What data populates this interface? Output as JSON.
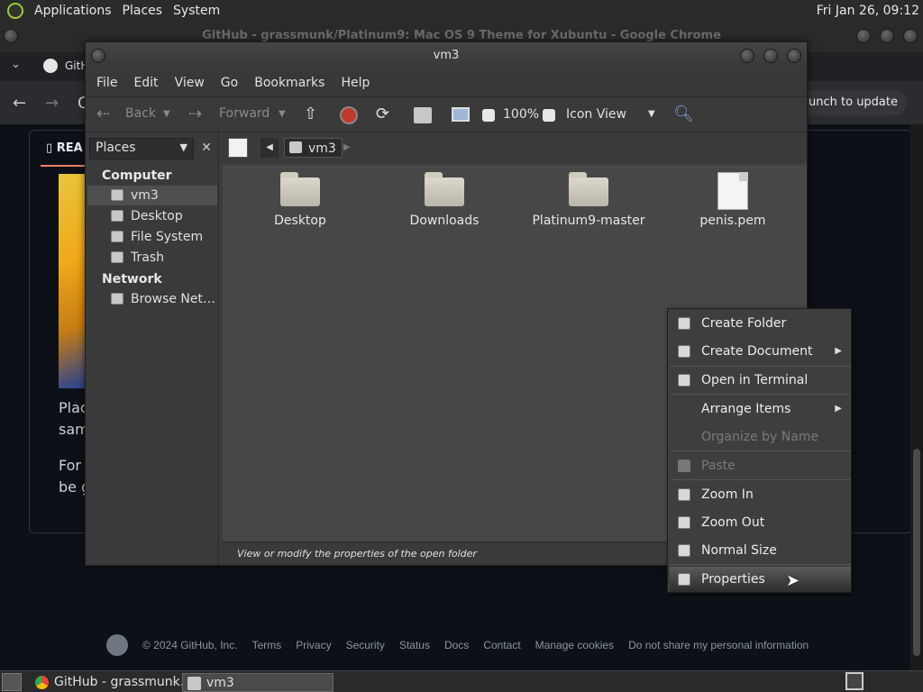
{
  "top_panel": {
    "menus": [
      "Applications",
      "Places",
      "System"
    ],
    "clock": "Fri Jan 26, 09:12"
  },
  "chrome": {
    "title": "GitHub - grassmunk/Platinum9: Mac OS 9 Theme for Xubuntu - Google Chrome",
    "tab_label": "GitH",
    "address_partial": "C",
    "relaunch_label": "aunch to update",
    "readme_tab": "REA",
    "readme_line1a": "Plac",
    "readme_line1b": "sam",
    "readme_line2a": "For",
    "readme_line2b": "be g",
    "footer": {
      "copyright": "© 2024 GitHub, Inc.",
      "links": [
        "Terms",
        "Privacy",
        "Security",
        "Status",
        "Docs",
        "Contact",
        "Manage cookies",
        "Do not share my personal information"
      ]
    }
  },
  "file_manager": {
    "title": "vm3",
    "menu": [
      "File",
      "Edit",
      "View",
      "Go",
      "Bookmarks",
      "Help"
    ],
    "toolbar": {
      "back": "Back",
      "forward": "Forward",
      "zoom": "100%",
      "view_mode": "Icon View"
    },
    "sidebar": {
      "selector": "Places",
      "computer_header": "Computer",
      "computer_items": [
        "vm3",
        "Desktop",
        "File System",
        "Trash"
      ],
      "network_header": "Network",
      "network_items": [
        "Browse Net…"
      ]
    },
    "path": {
      "current": "vm3"
    },
    "files": [
      {
        "name": "Desktop",
        "type": "folder"
      },
      {
        "name": "Downloads",
        "type": "folder"
      },
      {
        "name": "Platinum9-master",
        "type": "folder"
      },
      {
        "name": "penis.pem",
        "type": "file"
      }
    ],
    "status": "View or modify the properties of the open folder"
  },
  "context_menu": {
    "items": [
      {
        "label": "Create Folder",
        "enabled": true
      },
      {
        "label": "Create Document",
        "enabled": true,
        "submenu": true
      },
      {
        "label": "Open in Terminal",
        "enabled": true
      },
      {
        "label": "Arrange Items",
        "enabled": true,
        "submenu": true
      },
      {
        "label": "Organize by Name",
        "enabled": false
      },
      {
        "label": "Paste",
        "enabled": false
      },
      {
        "label": "Zoom In",
        "enabled": true
      },
      {
        "label": "Zoom Out",
        "enabled": true
      },
      {
        "label": "Normal Size",
        "enabled": true
      },
      {
        "label": "Properties",
        "enabled": true,
        "highlighted": true
      }
    ]
  },
  "taskbar": {
    "tasks": [
      "GitHub - grassmunk…",
      "vm3"
    ]
  }
}
